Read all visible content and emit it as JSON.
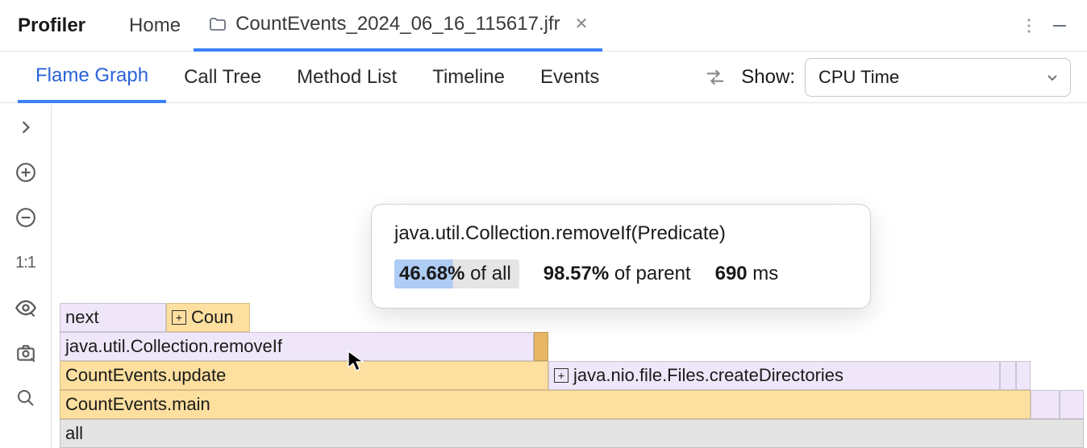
{
  "topbar": {
    "title": "Profiler",
    "home_tab": "Home",
    "file_tab": "CountEvents_2024_06_16_115617.jfr"
  },
  "subtabs": {
    "items": [
      "Flame Graph",
      "Call Tree",
      "Method List",
      "Timeline",
      "Events"
    ],
    "active_index": 0
  },
  "show": {
    "label": "Show:",
    "value": "CPU Time"
  },
  "sidebar": {
    "ratio_label": "1:1"
  },
  "flame": {
    "all": "all",
    "main": "CountEvents.main",
    "update": "CountEvents.update",
    "createDirs": "java.nio.file.Files.createDirectories",
    "removeIf": "java.util.Collection.removeIf",
    "next": "next",
    "coun": "Coun"
  },
  "tooltip": {
    "method": "java.util.Collection.removeIf(Predicate)",
    "pct_all": "46.68%",
    "of_all": " of all",
    "pct_parent": "98.57%",
    "of_parent": " of parent",
    "ms_value": "690",
    "ms_unit": " ms"
  }
}
